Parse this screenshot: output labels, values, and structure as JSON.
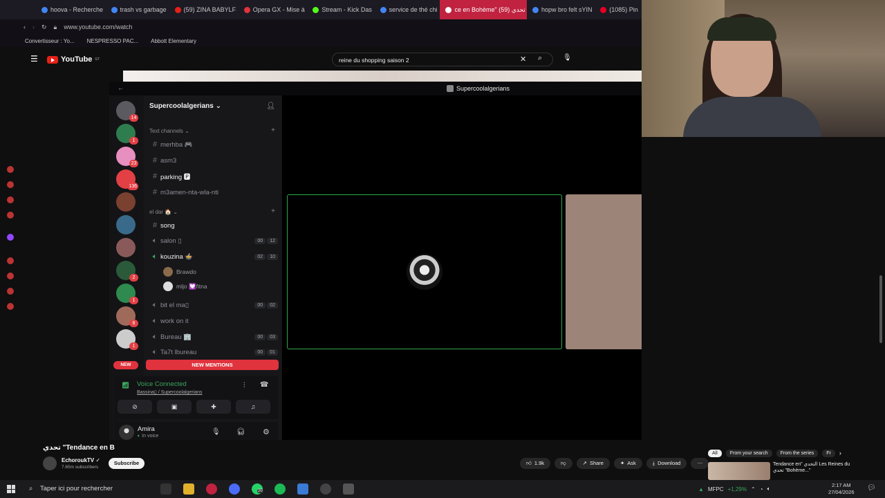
{
  "browser": {
    "tabs": [
      {
        "label": "hoova - Recherche",
        "color": "#4285f4"
      },
      {
        "label": "trash vs garbage",
        "color": "#4285f4"
      },
      {
        "label": "(59) ZINA BABYLF",
        "color": "#e62117"
      },
      {
        "label": "Opera GX - Mise à",
        "color": "#e0333d"
      },
      {
        "label": "Stream - Kick Das",
        "color": "#53fc18"
      },
      {
        "label": "service de thé chi",
        "color": "#4285f4"
      },
      {
        "label": "ce en Bohème\" تحدي (59)",
        "color": "#e62117",
        "active": true
      },
      {
        "label": "hopw bro felt sYIN",
        "color": "#4285f4"
      },
      {
        "label": "(1085) Pin",
        "color": "#e60023"
      }
    ],
    "url": "www.youtube.com/watch",
    "bookmarks": [
      "Convertisseur : Yo...",
      "NESPRESSO PAC...",
      "Abbott Elementary"
    ]
  },
  "youtube": {
    "logo": "YouTube",
    "country_code": "GT",
    "search_value": "reine du shopping saison 2",
    "video_title": "تحدي \"Tendance en B",
    "channel_name": "EchoroukTV",
    "channel_subs": "7.65m subscribers",
    "subscribe_label": "Subscribe",
    "likes": "1.9k",
    "share_label": "Share",
    "ask_label": "Ask",
    "download_label": "Download",
    "chips": [
      "All",
      "From your search",
      "From the series",
      "Fr"
    ],
    "rec_title": "Tendance en\" التحدي Les Reines du تحدي \"Bohème...\""
  },
  "discord": {
    "topbar_title": "Supercoolalgerians",
    "server_name": "Supercoolalgerians",
    "servers": [
      {
        "badge": "14",
        "color": "#5a5a60"
      },
      {
        "badge": "1",
        "color": "#2e7d4f"
      },
      {
        "badge": "23",
        "color": "#e78fbf"
      },
      {
        "badge": "136",
        "color": "#e24045"
      },
      {
        "badge": "",
        "color": "#7a4030"
      },
      {
        "badge": "",
        "color": "#3a6a8a"
      },
      {
        "badge": "",
        "color": "#8a5a5a"
      },
      {
        "badge": "2",
        "color": "#2a5a3a"
      },
      {
        "badge": "1",
        "color": "#2e8a4f"
      },
      {
        "badge": "8",
        "color": "#a06a5a"
      },
      {
        "badge": "1",
        "color": "#cccccc"
      }
    ],
    "text_category": "Text channels",
    "text_channels": [
      {
        "name": "merhba 🎮",
        "bright": false
      },
      {
        "name": "asm3",
        "bright": false
      },
      {
        "name": "parking 🅿",
        "bright": true
      },
      {
        "name": "m3amen-nta-wla-nti",
        "bright": false
      }
    ],
    "voice_category": "el dar 🏠",
    "voice_channels": [
      {
        "name": "song",
        "bright": true,
        "a": "",
        "b": ""
      },
      {
        "name": "salon ▯",
        "bright": false,
        "a": "00",
        "b": "12"
      },
      {
        "name": "kouzina 🍲",
        "bright": true,
        "a": "02",
        "b": "10"
      },
      {
        "name": "bit el ma▯",
        "bright": false,
        "a": "00",
        "b": "02"
      },
      {
        "name": "work on it",
        "bright": false,
        "a": "",
        "b": ""
      },
      {
        "name": "Bureau 🏢",
        "bright": false,
        "a": "00",
        "b": "03"
      },
      {
        "name": "Ta7t lbureau",
        "bright": false,
        "a": "00",
        "b": "01"
      }
    ],
    "voice_users": [
      "Brawdo",
      "mljo 💟fitna"
    ],
    "new_pill": "NEW",
    "new_mentions": "NEW MENTIONS",
    "voice_connected": "Voice Connected",
    "voice_location": "Bassina▯ / Supercoolalgerians",
    "user_name": "Amira",
    "user_status": "In voice"
  },
  "taskbar": {
    "search_placeholder": "Taper ici pour rechercher",
    "badge": "20",
    "weather": "MFPC",
    "market": "+1,29%",
    "time": "2:17 AM",
    "date": "27/04/2026"
  },
  "colors": {
    "accent": "#e0333d",
    "voice_green": "#3ba55d",
    "tile_border": "#2fa84f"
  }
}
